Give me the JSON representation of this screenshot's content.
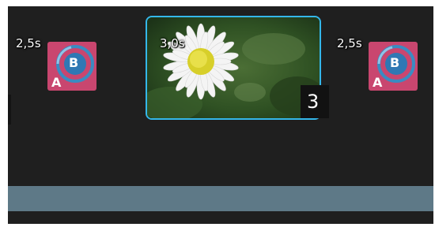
{
  "storyboard": {
    "items": [
      {
        "kind": "transition",
        "duration": "2,5s",
        "icon": "transition-a-b-icon",
        "letter_a": "A",
        "letter_b": "B",
        "color": "#c9466f"
      },
      {
        "kind": "clip",
        "duration": "3,0s",
        "thumbnail": "daisy-photo",
        "index": "3",
        "selected": true,
        "selection_color": "#34b7ea"
      },
      {
        "kind": "transition",
        "duration": "2,5s",
        "icon": "transition-a-b-icon",
        "letter_a": "A",
        "letter_b": "B",
        "color": "#c9466f"
      }
    ]
  },
  "timeline": {
    "background": "#1f1f1f",
    "audio_track_color": "#5e7987"
  }
}
